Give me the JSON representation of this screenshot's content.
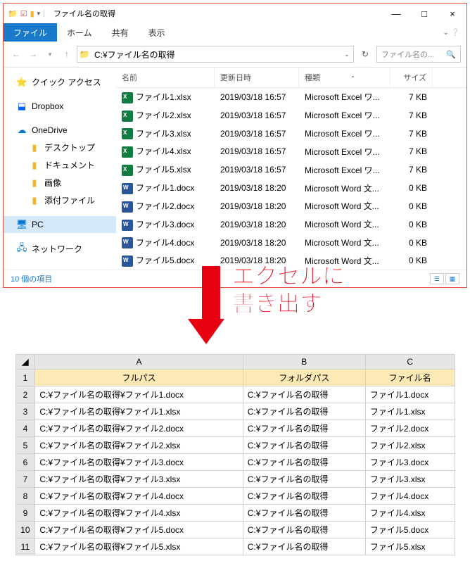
{
  "window": {
    "title": "ファイル名の取得",
    "minimize": "—",
    "maximize": "□",
    "close": "×"
  },
  "ribbon": {
    "file": "ファイル",
    "home": "ホーム",
    "share": "共有",
    "view": "表示"
  },
  "nav": {
    "address": "C:¥ファイル名の取得",
    "search_placeholder": "ファイル名の..."
  },
  "sidebar": {
    "quick": "クイック アクセス",
    "dropbox": "Dropbox",
    "onedrive": "OneDrive",
    "desktop": "デスクトップ",
    "documents": "ドキュメント",
    "pictures": "画像",
    "attachments": "添付ファイル",
    "pc": "PC",
    "network": "ネットワーク"
  },
  "columns": {
    "name": "名前",
    "date": "更新日時",
    "type": "種類",
    "size": "サイズ"
  },
  "files": [
    {
      "name": "ファイル1.xlsx",
      "date": "2019/03/18 16:57",
      "type": "Microsoft Excel ワ...",
      "size": "7 KB",
      "kind": "xlsx"
    },
    {
      "name": "ファイル2.xlsx",
      "date": "2019/03/18 16:57",
      "type": "Microsoft Excel ワ...",
      "size": "7 KB",
      "kind": "xlsx"
    },
    {
      "name": "ファイル3.xlsx",
      "date": "2019/03/18 16:57",
      "type": "Microsoft Excel ワ...",
      "size": "7 KB",
      "kind": "xlsx"
    },
    {
      "name": "ファイル4.xlsx",
      "date": "2019/03/18 16:57",
      "type": "Microsoft Excel ワ...",
      "size": "7 KB",
      "kind": "xlsx"
    },
    {
      "name": "ファイル5.xlsx",
      "date": "2019/03/18 16:57",
      "type": "Microsoft Excel ワ...",
      "size": "7 KB",
      "kind": "xlsx"
    },
    {
      "name": "ファイル1.docx",
      "date": "2019/03/18 18:20",
      "type": "Microsoft Word 文...",
      "size": "0 KB",
      "kind": "docx"
    },
    {
      "name": "ファイル2.docx",
      "date": "2019/03/18 18:20",
      "type": "Microsoft Word 文...",
      "size": "0 KB",
      "kind": "docx"
    },
    {
      "name": "ファイル3.docx",
      "date": "2019/03/18 18:20",
      "type": "Microsoft Word 文...",
      "size": "0 KB",
      "kind": "docx"
    },
    {
      "name": "ファイル4.docx",
      "date": "2019/03/18 18:20",
      "type": "Microsoft Word 文...",
      "size": "0 KB",
      "kind": "docx"
    },
    {
      "name": "ファイル5.docx",
      "date": "2019/03/18 18:20",
      "type": "Microsoft Word 文...",
      "size": "0 KB",
      "kind": "docx"
    }
  ],
  "status": {
    "count": "10 個の項目"
  },
  "annotation": {
    "line1": "エクセルに",
    "line2": "書き出す"
  },
  "excel": {
    "cols": [
      "A",
      "B",
      "C"
    ],
    "headers": [
      "フルパス",
      "フォルダパス",
      "ファイル名"
    ],
    "rows": [
      [
        "C:¥ファイル名の取得¥ファイル1.docx",
        "C:¥ファイル名の取得",
        "ファイル1.docx"
      ],
      [
        "C:¥ファイル名の取得¥ファイル1.xlsx",
        "C:¥ファイル名の取得",
        "ファイル1.xlsx"
      ],
      [
        "C:¥ファイル名の取得¥ファイル2.docx",
        "C:¥ファイル名の取得",
        "ファイル2.docx"
      ],
      [
        "C:¥ファイル名の取得¥ファイル2.xlsx",
        "C:¥ファイル名の取得",
        "ファイル2.xlsx"
      ],
      [
        "C:¥ファイル名の取得¥ファイル3.docx",
        "C:¥ファイル名の取得",
        "ファイル3.docx"
      ],
      [
        "C:¥ファイル名の取得¥ファイル3.xlsx",
        "C:¥ファイル名の取得",
        "ファイル3.xlsx"
      ],
      [
        "C:¥ファイル名の取得¥ファイル4.docx",
        "C:¥ファイル名の取得",
        "ファイル4.docx"
      ],
      [
        "C:¥ファイル名の取得¥ファイル4.xlsx",
        "C:¥ファイル名の取得",
        "ファイル4.xlsx"
      ],
      [
        "C:¥ファイル名の取得¥ファイル5.docx",
        "C:¥ファイル名の取得",
        "ファイル5.docx"
      ],
      [
        "C:¥ファイル名の取得¥ファイル5.xlsx",
        "C:¥ファイル名の取得",
        "ファイル5.xlsx"
      ]
    ]
  }
}
